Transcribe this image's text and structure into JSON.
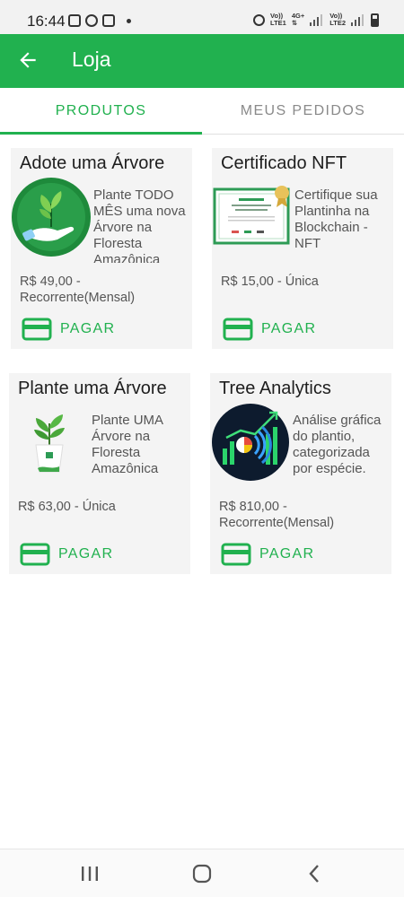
{
  "status_bar": {
    "time": "16:44",
    "net1_top": "Vo))",
    "net1_bottom": "LTE1",
    "net_4g": "4G+",
    "net2_top": "Vo))",
    "net2_bottom": "LTE2"
  },
  "app_bar": {
    "title": "Loja",
    "back_icon": "arrow-left-icon",
    "background_color": "#21b14f"
  },
  "tabs": [
    {
      "label": "PRODUTOS",
      "active": true
    },
    {
      "label": "MEUS PEDIDOS",
      "active": false
    }
  ],
  "accent_color": "#21b14f",
  "products": [
    {
      "title": "Adote uma Árvore",
      "image": "hand-holding-plant-icon",
      "description": "Plante TODO MÊS uma nova Árvore na Floresta Amazônica",
      "price": "R$ 49,00 - Recorrente(Mensal)",
      "pay_label": "PAGAR",
      "pay_icon": "credit-card-icon"
    },
    {
      "title": "Certificado NFT",
      "image": "certificate-icon",
      "description": "Certifique sua Plantinha na Blockchain - NFT",
      "price": "R$ 15,00 - Única",
      "pay_label": "PAGAR",
      "pay_icon": "credit-card-icon"
    },
    {
      "title": "Plante uma Árvore",
      "image": "potted-plant-icon",
      "description": "Plante UMA Árvore na Floresta Amazônica",
      "price": "R$ 63,00 - Única",
      "pay_label": "PAGAR",
      "pay_icon": "credit-card-icon"
    },
    {
      "title": "Tree Analytics",
      "image": "analytics-chart-icon",
      "description": "Análise gráfica do plantio, categorizada por espécie.",
      "price": "R$ 810,00 - Recorrente(Mensal)",
      "pay_label": "PAGAR",
      "pay_icon": "credit-card-icon"
    }
  ],
  "nav_bar": {
    "recents_icon": "recents-icon",
    "home_icon": "home-icon",
    "back_icon": "back-chevron-icon"
  }
}
